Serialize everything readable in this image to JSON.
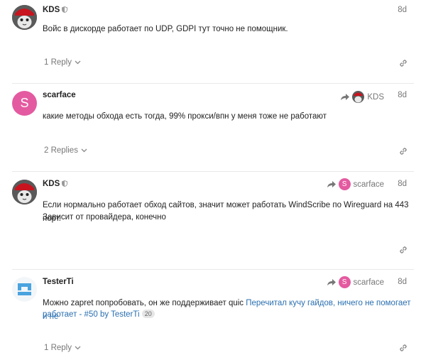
{
  "posts": [
    {
      "username": "KDS",
      "date": "8d",
      "text": "Войс в дискорде работает по UDP, GDPI тут точно не помощник.",
      "replies_label": "1 Reply"
    },
    {
      "username": "scarface",
      "avatar_letter": "S",
      "date": "8d",
      "reply_to_name": "KDS",
      "text": "какие методы обхода есть тогда, 99% прокси/впн у меня тоже не работают",
      "replies_label": "2 Replies"
    },
    {
      "username": "KDS",
      "date": "8d",
      "reply_to_name": "scarface",
      "reply_to_letter": "S",
      "text_line1": "Если нормально работает обход сайтов, значит может работать WindScribe по Wireguard на 443 порт.",
      "text_line2": "Зависит от провайдера, конечно"
    },
    {
      "username": "TesterTi",
      "date": "8d",
      "reply_to_name": "scarface",
      "reply_to_letter": "S",
      "text_plain": "Можно zapret попробовать, он же поддерживает quic",
      "quote_link_line1": "Перечитал кучу гайдов, ничего не помогает и не",
      "quote_link_line2": "работает - #50 by TesterTi",
      "quote_badge": "20",
      "replies_label": "1 Reply"
    }
  ],
  "colors": {
    "accent_link": "#2a6fb0",
    "avatar_pink": "#e45aa0",
    "muted": "#777777"
  }
}
